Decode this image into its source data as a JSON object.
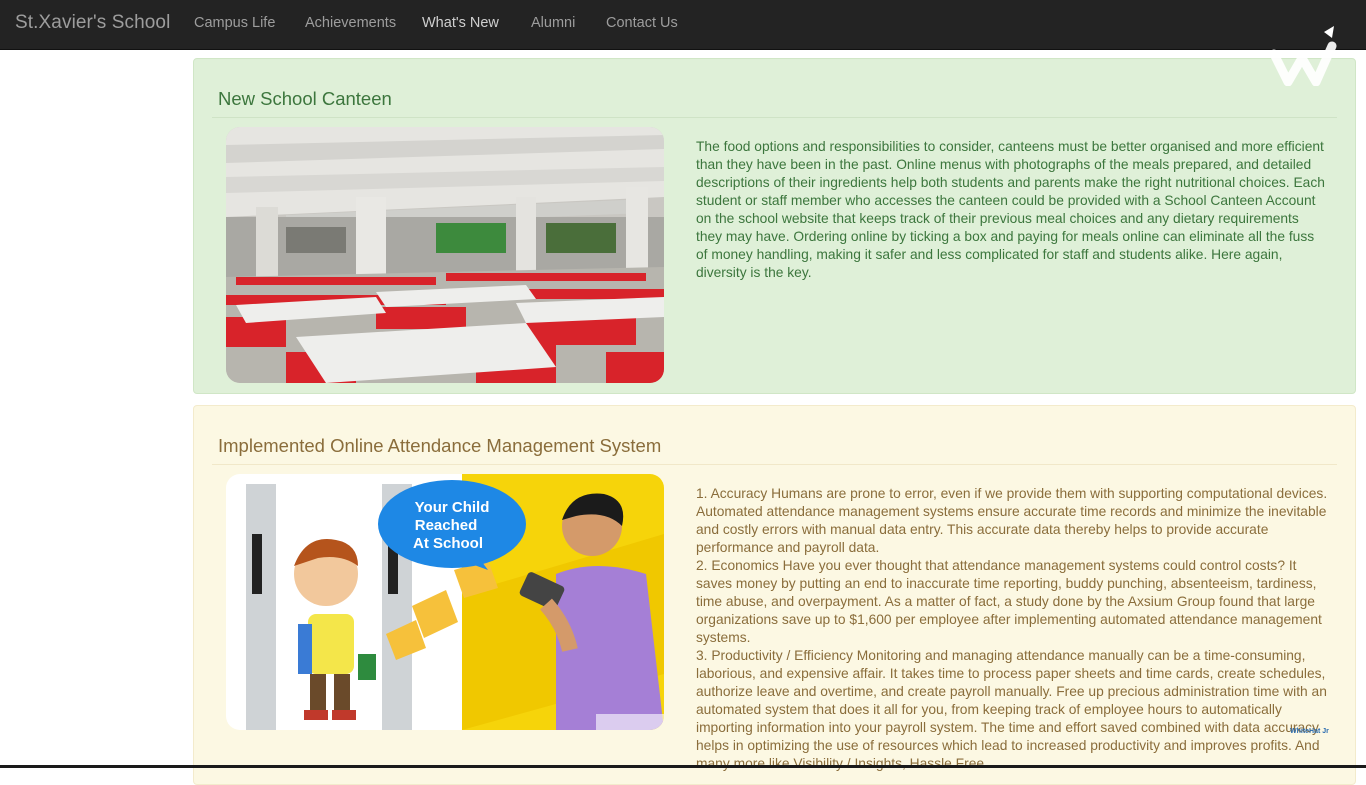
{
  "navbar": {
    "brand": "St.Xavier's School",
    "links": [
      {
        "label": "Campus Life",
        "active": false
      },
      {
        "label": "Achievements",
        "active": false
      },
      {
        "label": "What's New",
        "active": true
      },
      {
        "label": "Alumni",
        "active": false
      },
      {
        "label": "Contact Us",
        "active": false
      }
    ]
  },
  "panels": [
    {
      "title": "New School Canteen",
      "paragraphs": [
        "The food options and responsibilities to consider, canteens must be better organised and more efficient than they have been in the past. Online menus with photographs of the meals prepared, and detailed descriptions of their ingredients help both students and parents make the right nutritional choices. Each student or staff member who accesses the canteen could be provided with a School Canteen Account on the school website that keeps track of their previous meal choices and any dietary requirements they may have. Ordering online by ticking a box and paying for meals online can eliminate all the fuss of money handling, making it safer and less complicated for staff and students alike. Here again, diversity is the key."
      ]
    },
    {
      "title": "Implemented Online Attendance Management System",
      "image_caption": "Your Child Reached At School",
      "paragraphs": [
        "1. Accuracy Humans are prone to error, even if we provide them with supporting computational devices. Automated attendance management systems ensure accurate time records and minimize the inevitable and costly errors with manual data entry. This accurate data thereby helps to provide accurate performance and payroll data.",
        "2. Economics Have you ever thought that attendance management systems could control costs? It saves money by putting an end to inaccurate time reporting, buddy punching, absenteeism, tardiness, time abuse, and overpayment. As a matter of fact, a study done by the Axsium Group found that large organizations save up to $1,600 per employee after implementing automated attendance management systems.",
        "3. Productivity / Efficiency Monitoring and managing attendance manually can be a time-consuming, laborious, and expensive affair. It takes time to process paper sheets and time cards, create schedules, authorize leave and overtime, and create payroll manually. Free up precious administration time with an automated system that does it all for you, from keeping track of employee hours to automatically importing information into your payroll system. The time and effort saved combined with data accuracy helps in optimizing the use of resources which lead to increased productivity and improves profits. And many more like Visibility / Insights, Hassle Free"
      ]
    }
  ],
  "watermark": "WhiteHat Jr",
  "colors": {
    "navbar_bg": "#232323",
    "success_bg": "#dff0d8",
    "success_text": "#3c763d",
    "warning_bg": "#fcf8e3",
    "warning_text": "#8a6d3b"
  }
}
